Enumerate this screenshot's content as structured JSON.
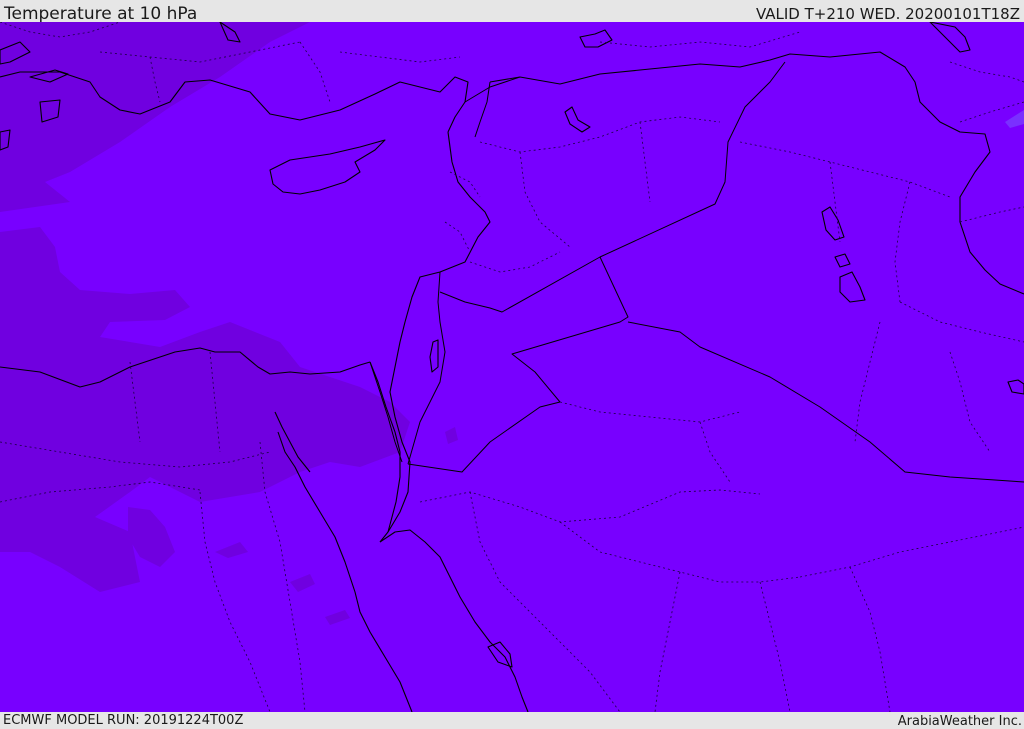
{
  "header": {
    "title": "Temperature at 10 hPa",
    "valid": "VALID T+210 WED. 20200101T18Z"
  },
  "footer": {
    "model_run": "ECMWF MODEL RUN: 20191224T00Z",
    "credit": "ArabiaWeather Inc."
  },
  "colors": {
    "field_main": "#7800ff",
    "field_cold": "#7000e0",
    "coastline": "#000000",
    "border": "#000000",
    "bar_background": "#e6e6e6"
  },
  "map": {
    "variable": "Temperature",
    "level": "10 hPa",
    "boundaries": [
      "coastlines",
      "country-borders",
      "province-borders-dotted"
    ]
  }
}
